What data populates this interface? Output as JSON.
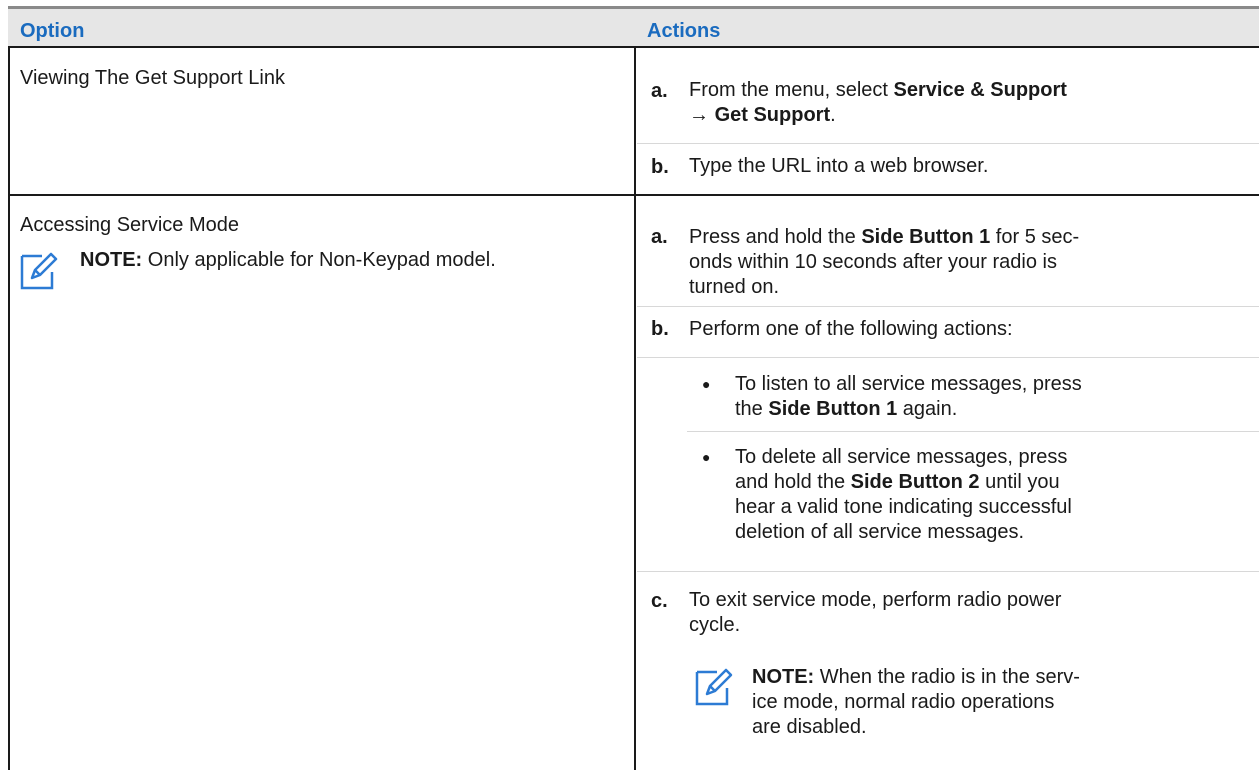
{
  "header": {
    "option": "Option",
    "actions": "Actions"
  },
  "rows": [
    {
      "option": "Viewing The Get Support Link",
      "steps": [
        {
          "label": "a.",
          "parts": [
            "From the menu, select ",
            "Service & Support",
            "→ ",
            "Get Support",
            "."
          ]
        },
        {
          "label": "b.",
          "text": "Type the URL into a web browser."
        }
      ]
    },
    {
      "option": "Accessing Service Mode",
      "note": {
        "label": "NOTE:",
        "text": " Only applicable for Non-Keypad model."
      },
      "steps": [
        {
          "label": "a.",
          "parts": [
            "Press and hold the ",
            "Side Button 1",
            " for 5 sec-",
            "onds within 10 seconds after your radio is",
            "turned on."
          ]
        },
        {
          "label": "b.",
          "text": "Perform one of the following actions:",
          "bullets": [
            {
              "parts": [
                "To listen to all service messages, press",
                "the ",
                "Side Button 1",
                " again."
              ]
            },
            {
              "parts": [
                "To delete all service messages, press",
                "and hold the ",
                "Side Button 2",
                " until you",
                "hear a valid tone indicating successful",
                "deletion of all service messages."
              ]
            }
          ]
        },
        {
          "label": "c.",
          "text": "To exit service mode, perform radio power",
          "text2": "cycle.",
          "note": {
            "label": "NOTE:",
            "text": " When the radio is in the serv-",
            "text2": "ice mode, normal radio operations",
            "text3": "are disabled."
          }
        }
      ]
    }
  ]
}
